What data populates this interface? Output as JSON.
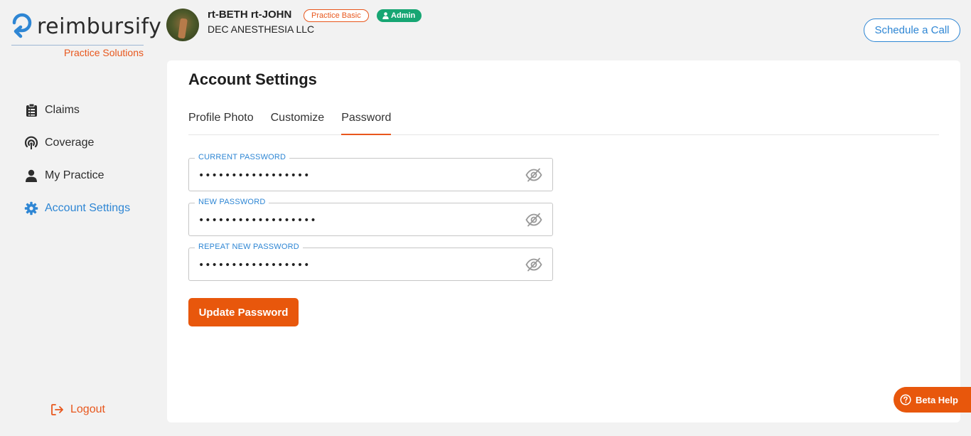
{
  "brand": {
    "name": "reimbursify",
    "subtitle": "Practice Solutions",
    "accent": "#e8571d",
    "blue": "#2e86d4"
  },
  "header": {
    "user_name": "rt-BETH rt-JOHN",
    "plan_badge": "Practice Basic",
    "role_badge": "Admin",
    "org_name": "DEC ANESTHESIA LLC",
    "schedule_label": "Schedule a Call"
  },
  "sidebar": {
    "items": [
      {
        "label": "Claims",
        "icon": "clipboard-icon",
        "active": false
      },
      {
        "label": "Coverage",
        "icon": "coverage-icon",
        "active": false
      },
      {
        "label": "My Practice",
        "icon": "user-icon",
        "active": false
      },
      {
        "label": "Account Settings",
        "icon": "gear-icon",
        "active": true
      }
    ],
    "logout_label": "Logout"
  },
  "main": {
    "title": "Account Settings",
    "tabs": [
      {
        "label": "Profile Photo",
        "active": false
      },
      {
        "label": "Customize",
        "active": false
      },
      {
        "label": "Password",
        "active": true
      }
    ],
    "fields": [
      {
        "label": "CURRENT PASSWORD",
        "value": "•••••••••••••••••"
      },
      {
        "label": "NEW PASSWORD",
        "value": "••••••••••••••••••"
      },
      {
        "label": "REPEAT NEW PASSWORD",
        "value": "•••••••••••••••••"
      }
    ],
    "update_label": "Update Password"
  },
  "help": {
    "label": "Beta Help"
  }
}
